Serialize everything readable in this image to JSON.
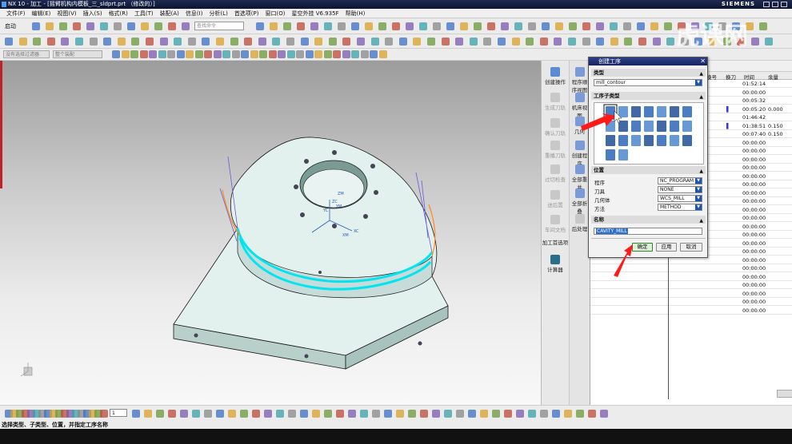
{
  "titlebar": {
    "title": "NX 10 - 加工 - [摇臂机构内模板_三_sldprt.prt （修改的）]",
    "brand": "SIEMENS"
  },
  "menu": [
    "文件(F)",
    "编辑(E)",
    "视图(V)",
    "插入(S)",
    "格式(R)",
    "工具(T)",
    "装配(A)",
    "信息(I)",
    "分析(L)",
    "首选项(P)",
    "窗口(O)",
    "星空外挂 V6.935F",
    "帮助(H)"
  ],
  "toolbar": {
    "start_label": "启动",
    "command_search_placeholder": "查找命令",
    "filter1": "没有选择过滤器",
    "filter2": "整个装配"
  },
  "resource_bar": [
    {
      "label": "创建操作",
      "enabled": true
    },
    {
      "label": "生成刀轨",
      "enabled": false
    },
    {
      "label": "确认刀轨",
      "enabled": false
    },
    {
      "label": "重播刀轨",
      "enabled": false
    },
    {
      "label": "过切检查",
      "enabled": false
    },
    {
      "label": "送后置",
      "enabled": false
    },
    {
      "label": "车间文档",
      "enabled": false
    },
    {
      "label": "加工首选项",
      "enabled": true
    },
    {
      "label": "计算器",
      "enabled": true
    }
  ],
  "resource_bar2": [
    "程序顺序视图",
    "机床视图",
    "几何",
    "创建程序",
    "全部重并",
    "全部折叠",
    "后处理"
  ],
  "navigator": {
    "columns": [
      "换号",
      "换刀",
      "时间",
      "余量"
    ],
    "rows": [
      {
        "tool": "",
        "time": "01:52:14",
        "stock": ""
      },
      {
        "tool": "",
        "time": "00:00:00",
        "stock": ""
      },
      {
        "tool": "",
        "time": "00:05:32",
        "stock": ""
      },
      {
        "tool": "▌",
        "time": "00:05:20",
        "stock": "0.000"
      },
      {
        "tool": "",
        "time": "01:46:42",
        "stock": ""
      },
      {
        "tool": "▌",
        "time": "01:38:51",
        "stock": "0.150"
      },
      {
        "tool": "",
        "time": "00:07:40",
        "stock": "0.150"
      },
      {
        "tool": "",
        "time": "00:00:00",
        "stock": ""
      },
      {
        "tool": "",
        "time": "00:00:00",
        "stock": ""
      },
      {
        "tool": "",
        "time": "00:00:00",
        "stock": ""
      },
      {
        "tool": "",
        "time": "00:00:00",
        "stock": ""
      },
      {
        "tool": "",
        "time": "00:00:00",
        "stock": ""
      },
      {
        "tool": "",
        "time": "00:00:00",
        "stock": ""
      },
      {
        "tool": "",
        "time": "00:00:00",
        "stock": ""
      },
      {
        "tool": "",
        "time": "00:00:00",
        "stock": ""
      },
      {
        "tool": "",
        "time": "00:00:00",
        "stock": ""
      },
      {
        "tool": "",
        "time": "00:00:00",
        "stock": ""
      },
      {
        "tool": "",
        "time": "00:00:00",
        "stock": ""
      },
      {
        "tool": "",
        "time": "00:00:00",
        "stock": ""
      },
      {
        "tool": "",
        "time": "00:00:00",
        "stock": ""
      },
      {
        "tool": "",
        "time": "00:00:00",
        "stock": ""
      },
      {
        "tool": "",
        "time": "00:00:00",
        "stock": ""
      },
      {
        "tool": "",
        "time": "00:00:00",
        "stock": ""
      },
      {
        "tool": "",
        "time": "00:00:00",
        "stock": ""
      },
      {
        "tool": "",
        "time": "00:00:00",
        "stock": ""
      },
      {
        "tool": "",
        "time": "00:00:00",
        "stock": ""
      },
      {
        "tool": "",
        "time": "00:00:00",
        "stock": ""
      },
      {
        "tool": "",
        "time": "00:00:00",
        "stock": ""
      }
    ]
  },
  "dialog": {
    "title": "创建工序",
    "type_section": "类型",
    "type_value": "mill_contour",
    "subtype_section": "工序子类型",
    "location_section": "位置",
    "program_label": "程序",
    "program_value": "NC_PROGRAM",
    "tool_label": "刀具",
    "tool_value": "NONE",
    "geometry_label": "几何体",
    "geometry_value": "WCS_MILL",
    "method_label": "方法",
    "method_value": "METHOD",
    "name_section": "名称",
    "name_value": "CAVITY_MILL",
    "ok": "确定",
    "apply": "应用",
    "cancel": "取消"
  },
  "status": "选择类型、子类型、位置，并指定工序名称",
  "viewport": {
    "axis_labels": [
      "ZC",
      "YC",
      "XC",
      "XM",
      "YM",
      "ZM"
    ]
  },
  "watermark": "虎课网",
  "layer_value": "1",
  "colors": {
    "accent": "#1c55b0",
    "title": "#17255e",
    "toolpath": "#00e5f0",
    "part": "#e2f0ee",
    "arrow": "#ff1a1a"
  }
}
